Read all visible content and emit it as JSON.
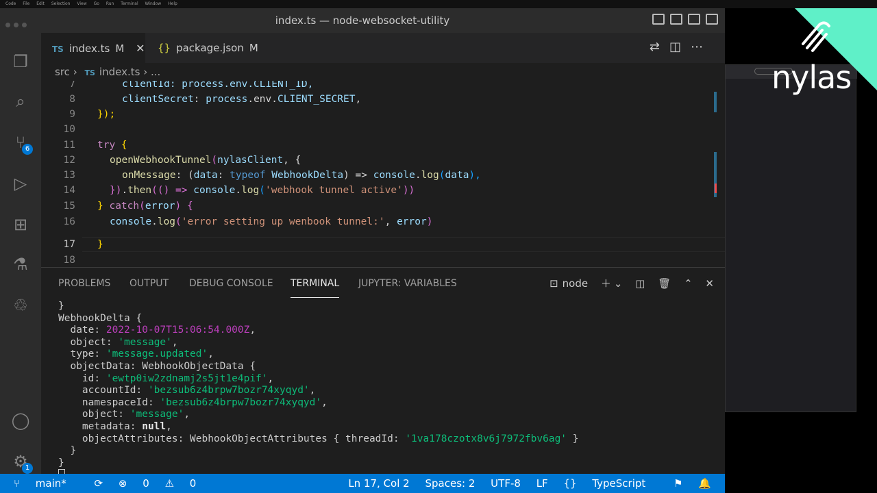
{
  "window": {
    "title": "index.ts — node-websocket-utility"
  },
  "menubar": {
    "items": [
      "Code",
      "File",
      "Edit",
      "Selection",
      "View",
      "Go",
      "Run",
      "Terminal",
      "Window",
      "Help"
    ]
  },
  "activity": {
    "scm_badge": "6",
    "accounts_badge": "1"
  },
  "tabs": [
    {
      "label": "index.ts",
      "lang": "TS",
      "modified": "M"
    },
    {
      "label": "package.json",
      "lang": "{}",
      "modified": "M"
    }
  ],
  "breadcrumb": {
    "folder": "src",
    "file": "index.ts",
    "lang": "TS",
    "more": "..."
  },
  "editor": {
    "line_numbers": [
      "7",
      "8",
      "9",
      "10",
      "11",
      "12",
      "13",
      "14",
      "15",
      "16",
      "17",
      "18"
    ],
    "lines": {
      "l7": "clientId: process.env.CLIENT_ID,",
      "l8a": "clientSecret",
      "l8b": ": ",
      "l8c": "process",
      "l8d": ".env.",
      "l8e": "CLIENT_SECRET",
      "l8f": ",",
      "l9": "});",
      "l11a": "try",
      "l11b": " {",
      "l12a": "openWebhookTunnel",
      "l12b": "(",
      "l12c": "nylasClient",
      "l12d": ", {",
      "l13a": "onMessage",
      "l13b": ": (",
      "l13c": "data",
      "l13d": ": ",
      "l13e": "typeof",
      "l13f": " ",
      "l13g": "WebhookDelta",
      "l13h": ") => ",
      "l13i": "console",
      "l13j": ".",
      "l13k": "log",
      "l13l": "(",
      "l13m": "data",
      "l13n": "),",
      "l14a": "})",
      "l14b": ".",
      "l14c": "then",
      "l14d": "(() => ",
      "l14e": "console",
      "l14f": ".",
      "l14g": "log",
      "l14h": "(",
      "l14i": "'webhook tunnel active'",
      "l14j": "))",
      "l15a": "}",
      "l15b": " catch",
      "l15c": "(",
      "l15d": "error",
      "l15e": ") {",
      "l16a": "console",
      "l16b": ".",
      "l16c": "log",
      "l16d": "(",
      "l16e": "'error setting up wenbook tunnel:'",
      "l16f": ", ",
      "l16g": "error",
      "l16h": ")",
      "l17": "}"
    }
  },
  "panel": {
    "tabs": [
      "PROBLEMS",
      "OUTPUT",
      "DEBUG CONSOLE",
      "TERMINAL",
      "JUPYTER: VARIABLES"
    ],
    "shell": "node",
    "terminal": {
      "t1": "}",
      "t2": "WebhookDelta {",
      "t3a": "  date: ",
      "t3b": "2022-10-07T15:06:54.000Z",
      "t3c": ",",
      "t4a": "  object: ",
      "t4b": "'message'",
      "t4c": ",",
      "t5a": "  type: ",
      "t5b": "'message.updated'",
      "t5c": ",",
      "t6": "  objectData: WebhookObjectData {",
      "t7a": "    id: ",
      "t7b": "'ewtp0iw2zdnamj2s5jt1e4pif'",
      "t7c": ",",
      "t8a": "    accountId: ",
      "t8b": "'bezsub6z4brpw7bozr74xyqyd'",
      "t8c": ",",
      "t9a": "    namespaceId: ",
      "t9b": "'bezsub6z4brpw7bozr74xyqyd'",
      "t9c": ",",
      "t10a": "    object: ",
      "t10b": "'message'",
      "t10c": ",",
      "t11a": "    metadata: ",
      "t11b": "null",
      "t11c": ",",
      "t12a": "    objectAttributes: WebhookObjectAttributes { threadId: ",
      "t12b": "'1va178czotx8v6j7972fbv6ag'",
      "t12c": " }",
      "t13": "  }",
      "t14": "}"
    }
  },
  "status": {
    "branch": "main*",
    "errors": "0",
    "warnings": "0",
    "position": "Ln 17, Col 2",
    "spaces": "Spaces: 2",
    "encoding": "UTF-8",
    "eol": "LF",
    "language": "TypeScript"
  },
  "brand": {
    "logo_text": "nylas",
    "accent": "#5ff0c8"
  },
  "colors": {
    "status_bar": "#0078d4",
    "editor_bg": "#1e1e1e"
  }
}
